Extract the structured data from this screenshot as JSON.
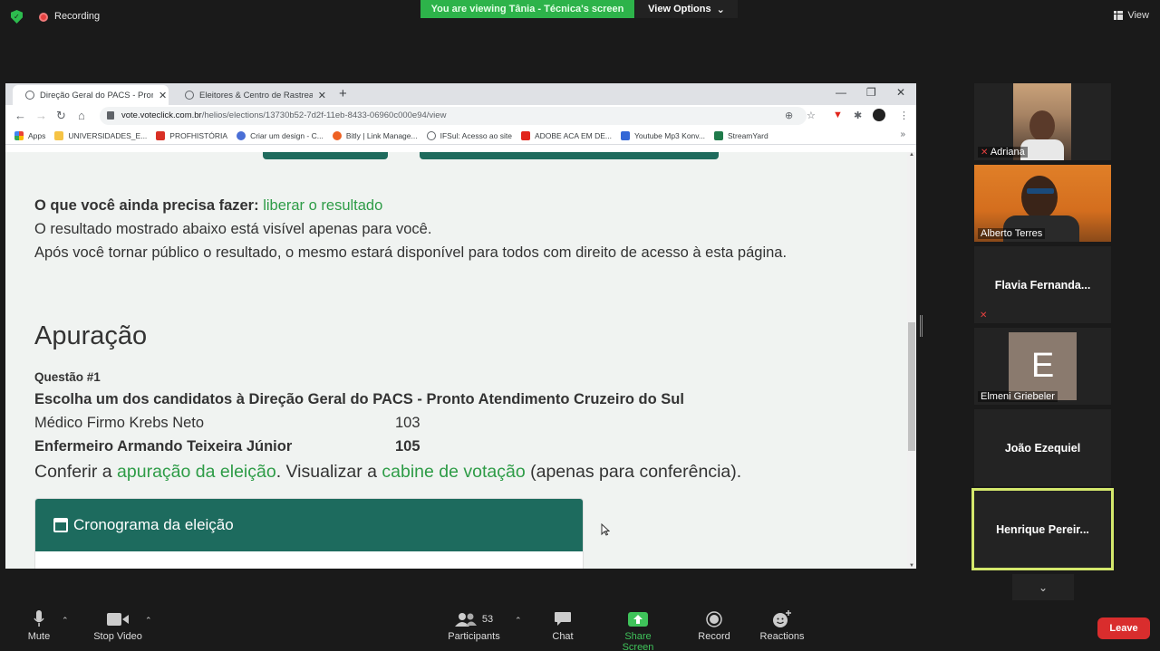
{
  "zoom": {
    "recording_label": "Recording",
    "viewing_banner": "You are viewing Tânia - Técnica's screen",
    "view_options_label": "View Options",
    "view_label": "View",
    "colors": {
      "banner": "#2db34a",
      "leave": "#d92d2d",
      "active_speaker": "#d4e86c"
    }
  },
  "browser": {
    "tabs": [
      {
        "title": "Direção Geral do PACS - Pronto Atendimento",
        "active": true
      },
      {
        "title": "Eleitores & Centro de Rastreamento",
        "active": false
      }
    ],
    "url_host": "vote.voteclick.com.br",
    "url_path": "/helios/elections/13730b52-7d2f-11eb-8433-06960c000e94/view",
    "bookmarks": [
      {
        "label": "Apps",
        "icon": "apps-grid-icon",
        "color": "#ea4335"
      },
      {
        "label": "UNIVERSIDADES_E...",
        "icon": "folder-icon",
        "color": "#f6c344"
      },
      {
        "label": "PROFHISTÓRIA",
        "icon": "h-logo-icon",
        "color": "#d93025"
      },
      {
        "label": "Criar um design - C...",
        "icon": "canva-icon",
        "color": "#4a6fd6"
      },
      {
        "label": "Bitly | Link Manage...",
        "icon": "bitly-icon",
        "color": "#ee6123"
      },
      {
        "label": "IFSul: Acesso ao site",
        "icon": "globe-icon",
        "color": "#5f6368"
      },
      {
        "label": "ADOBE ACA EM DE...",
        "icon": "adobe-icon",
        "color": "#e1251b"
      },
      {
        "label": "Youtube Mp3 Konv...",
        "icon": "youtube-icon",
        "color": "#3367d6"
      },
      {
        "label": "StreamYard",
        "icon": "streamyard-icon",
        "color": "#1f7a4a"
      }
    ]
  },
  "page": {
    "todo_label": "O que você ainda precisa fazer:",
    "todo_link": "liberar o resultado",
    "line2": "O resultado mostrado abaixo está visível apenas para você.",
    "line3": "Após você tornar público o resultado, o mesmo estará disponível para todos com direito de acesso à esta página.",
    "section_title": "Apuração",
    "question_label": "Questão #1",
    "question_text": "Escolha um dos candidatos à Direção Geral do PACS - Pronto Atendimento Cruzeiro do Sul",
    "results": [
      {
        "name": "Médico Firmo Krebs Neto",
        "votes": "103",
        "winner": false
      },
      {
        "name": "Enfermeiro Armando Teixeira Júnior",
        "votes": "105",
        "winner": true
      }
    ],
    "check_prefix": "Conferir a ",
    "check_link1": "apuração da eleição",
    "check_mid": ". Visualizar a ",
    "check_link2": "cabine de votação",
    "check_suffix": " (apenas para conferência).",
    "schedule_title": "Cronograma da eleição"
  },
  "participants": [
    {
      "name": "Adriana",
      "video": true,
      "muted": true
    },
    {
      "name": "Alberto Terres",
      "video": true,
      "muted": false
    },
    {
      "name": "Flavia  Fernanda...",
      "video": false,
      "muted": true
    },
    {
      "name": "Elmeni Griebeler",
      "initial": "E",
      "video": false,
      "muted": false
    },
    {
      "name": "João Ezequiel",
      "video": false,
      "muted": false
    },
    {
      "name": "Henrique  Pereir...",
      "video": false,
      "muted": false,
      "active": true
    }
  ],
  "controls": {
    "mute": "Mute",
    "stop_video": "Stop Video",
    "participants": "Participants",
    "participants_count": "53",
    "chat": "Chat",
    "share_screen": "Share Screen",
    "record": "Record",
    "reactions": "Reactions",
    "leave": "Leave"
  }
}
